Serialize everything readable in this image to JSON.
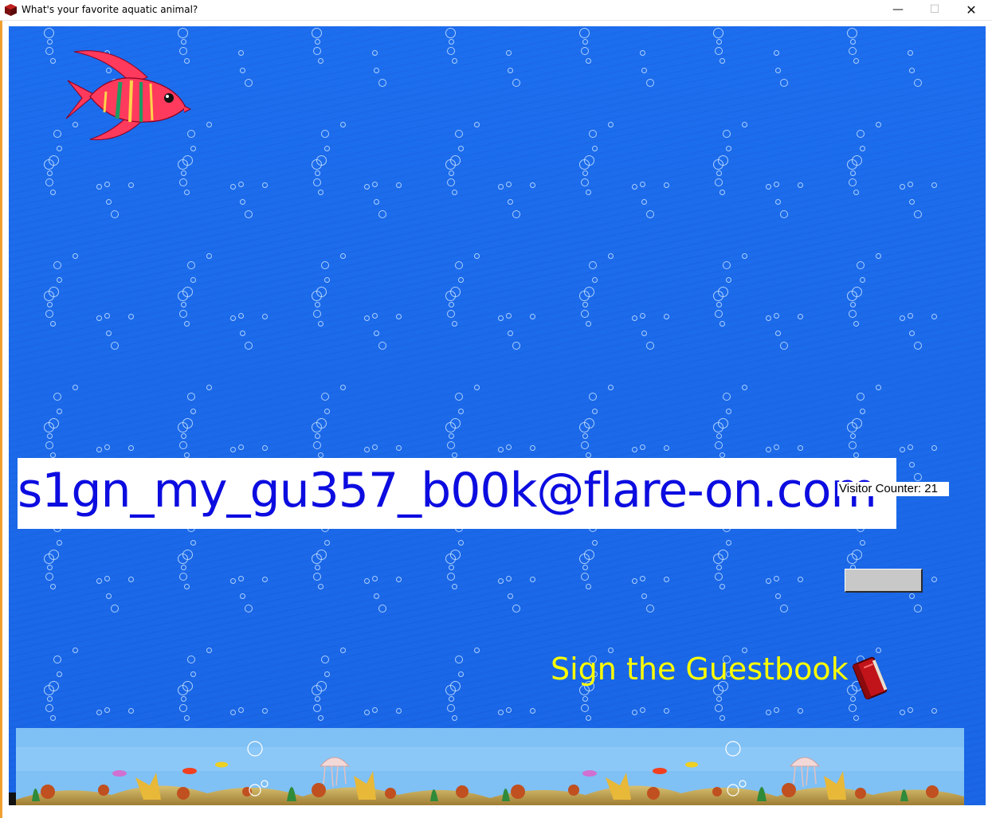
{
  "window": {
    "title": "What's your favorite aquatic animal?",
    "icon": "red-cube-icon",
    "controls": {
      "minimize": "—",
      "maximize": "☐",
      "close": "✕"
    }
  },
  "main": {
    "email": "s1gn_my_gu357_b00k@flare-on.com",
    "visitor_counter": "Visitor Counter: 21",
    "guestbook_link": "Sign the Guestbook",
    "guestbook_icon": "red-book-icon",
    "fish_icon": "angelfish-icon",
    "gray_button_label": ""
  },
  "colors": {
    "water": "#1d6eee",
    "email_text": "#0c0ce0",
    "guestbook_text": "#ffff00",
    "fish_body": "#ff3a5c",
    "fish_stripe": "#20a060",
    "button_face": "#c8c8c8"
  }
}
